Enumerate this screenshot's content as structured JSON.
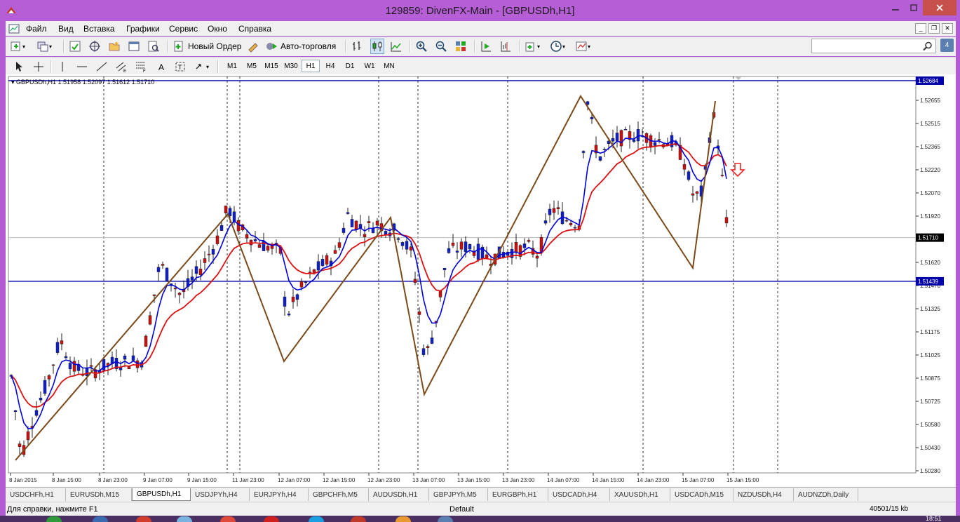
{
  "window": {
    "title": "129859: DivenFX-Main - [GBPUSDh,H1]"
  },
  "menu": [
    "Файл",
    "Вид",
    "Вставка",
    "Графики",
    "Сервис",
    "Окно",
    "Справка"
  ],
  "toolbar": {
    "new_order": "Новый Ордер",
    "auto_trading": "Авто-торговля",
    "search_placeholder": "",
    "notifications": "4"
  },
  "timeframes": [
    "M1",
    "M5",
    "M15",
    "M30",
    "H1",
    "H4",
    "D1",
    "W1",
    "MN"
  ],
  "active_timeframe": "H1",
  "chart": {
    "info": "GBPUSDh,H1  1.51958 1.52097 1.51612 1.51710",
    "price_labels": [
      "1.52655",
      "1.52515",
      "1.52365",
      "1.52220",
      "1.52070",
      "1.51920",
      "1.51770",
      "1.51620",
      "1.51470",
      "1.51325",
      "1.51175",
      "1.51025",
      "1.50875",
      "1.50725",
      "1.50580",
      "1.50430",
      "1.50280"
    ],
    "hline_upper": "1.52684",
    "hline_lower": "1.51439",
    "current_price": "1.51710",
    "time_labels": [
      "8 Jan 2015",
      "8 Jan 15:00",
      "8 Jan 23:00",
      "9 Jan 07:00",
      "9 Jan 15:00",
      "11 Jan 23:00",
      "12 Jan 07:00",
      "12 Jan 15:00",
      "12 Jan 23:00",
      "13 Jan 07:00",
      "13 Jan 15:00",
      "13 Jan 23:00",
      "14 Jan 07:00",
      "14 Jan 15:00",
      "14 Jan 23:00",
      "15 Jan 07:00",
      "15 Jan 15:00"
    ],
    "colors": {
      "bull": "#cc1010",
      "bear": "#1020c8",
      "ma_fast": "#0000dd",
      "ma_slow": "#dd1111",
      "zigzag": "#7a4a1a",
      "hline": "#0000aa",
      "arrow": "#ee2222"
    }
  },
  "tabs": [
    "USDCHFh,H1",
    "EURUSDh,M15",
    "GBPUSDh,H1",
    "USDJPYh,H4",
    "EURJPYh,H4",
    "GBPCHFh,M5",
    "AUDUSDh,H1",
    "GBPJPYh,M5",
    "EURGBPh,H1",
    "USDCADh,H4",
    "XAUUSDh,H1",
    "USDCADh,M15",
    "NZDUSDh,H4",
    "AUDNZDh,Daily"
  ],
  "active_tab": "GBPUSDh,H1",
  "status": {
    "help": "Для справки, нажмите F1",
    "profile": "Default",
    "connection": "40501/15 kb"
  },
  "taskbar": {
    "clock": "18:51"
  }
}
